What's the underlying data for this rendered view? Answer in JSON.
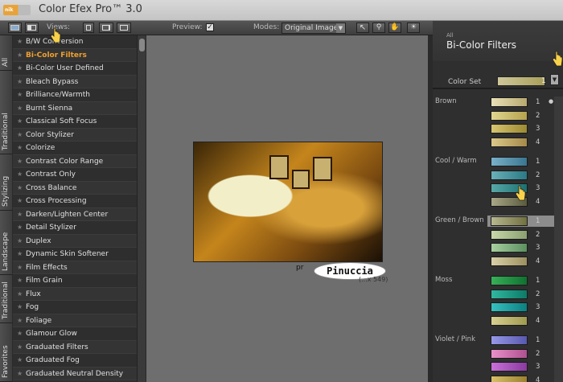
{
  "window": {
    "title": "Color Efex Pro™ 3.0",
    "logo_text": "nik Software"
  },
  "toolbar": {
    "views_label": "Views:",
    "preview_label": "Preview:",
    "preview_checked": "✓",
    "modes_label": "Modes:",
    "mode_value": "Original Image",
    "icons": [
      "arrow-icon",
      "zoom-icon",
      "hand-icon",
      "lightbulb-icon"
    ]
  },
  "side_tabs": [
    "All",
    "Traditional",
    "Stylizing",
    "Landscape",
    "Traditional",
    "Favorites"
  ],
  "filters": [
    "B/W Conversion",
    "Bi-Color Filters",
    "Bi-Color User Defined",
    "Bleach Bypass",
    "Brilliance/Warmth",
    "Burnt Sienna",
    "Classical Soft Focus",
    "Color Stylizer",
    "Colorize",
    "Contrast Color Range",
    "Contrast Only",
    "Cross Balance",
    "Cross Processing",
    "Darken/Lighten Center",
    "Detail Stylizer",
    "Duplex",
    "Dynamic Skin Softener",
    "Film Effects",
    "Film Grain",
    "Flux",
    "Fog",
    "Foliage",
    "Glamour Glow",
    "Graduated Filters",
    "Graduated Fog",
    "Graduated Neutral Density"
  ],
  "active_filter": "Bi-Color Filters",
  "canvas": {
    "caption_prefix": "pr",
    "watermark": "Pinuccia",
    "dims": "(...x 549)"
  },
  "panel": {
    "category": "All",
    "title": "Bi-Color Filters",
    "color_set_label": "Color Set",
    "color_set_value": "1",
    "groups": [
      {
        "name": "Brown",
        "swatches": [
          {
            "n": "1",
            "colors": [
              "#e8e0b8",
              "#b8a870"
            ]
          },
          {
            "n": "2",
            "colors": [
              "#e0d690",
              "#b4a24e"
            ]
          },
          {
            "n": "3",
            "colors": [
              "#d8c670",
              "#9c8a32"
            ]
          },
          {
            "n": "4",
            "colors": [
              "#dcc88a",
              "#a48a4a"
            ]
          }
        ]
      },
      {
        "name": "Cool / Warm",
        "swatches": [
          {
            "n": "1",
            "colors": [
              "#7ab0c8",
              "#3a7690"
            ]
          },
          {
            "n": "2",
            "colors": [
              "#6ab0b8",
              "#2a7a86"
            ]
          },
          {
            "n": "3",
            "colors": [
              "#58a8a8",
              "#1c7070"
            ]
          },
          {
            "n": "4",
            "colors": [
              "#a8a888",
              "#5a5a3e"
            ]
          }
        ]
      },
      {
        "name": "Green / Brown",
        "swatches": [
          {
            "n": "1",
            "colors": [
              "#b8b890",
              "#707040"
            ]
          },
          {
            "n": "2",
            "colors": [
              "#c8d8a8",
              "#8aa070"
            ]
          },
          {
            "n": "3",
            "colors": [
              "#a8d0a0",
              "#5c9060"
            ]
          },
          {
            "n": "4",
            "colors": [
              "#d8d0a8",
              "#9c9060"
            ]
          }
        ]
      },
      {
        "name": "Moss",
        "swatches": [
          {
            "n": "1",
            "colors": [
              "#38b058",
              "#107030"
            ]
          },
          {
            "n": "2",
            "colors": [
              "#30b8a0",
              "#0c7a68"
            ]
          },
          {
            "n": "3",
            "colors": [
              "#38c0c0",
              "#0c8080"
            ]
          },
          {
            "n": "4",
            "colors": [
              "#d8d090",
              "#a09a50"
            ]
          }
        ]
      },
      {
        "name": "Violet / Pink",
        "swatches": [
          {
            "n": "1",
            "colors": [
              "#9898e8",
              "#5858b0"
            ]
          },
          {
            "n": "2",
            "colors": [
              "#e890c8",
              "#b05090"
            ]
          },
          {
            "n": "3",
            "colors": [
              "#c870d8",
              "#8a3aa0"
            ]
          },
          {
            "n": "4",
            "colors": [
              "#d8c068",
              "#9a8030"
            ]
          }
        ]
      }
    ]
  },
  "colors": {
    "accent": "#f0a030",
    "panel_bg": "#2f2f2f",
    "canvas_bg": "#6e6e6e"
  }
}
